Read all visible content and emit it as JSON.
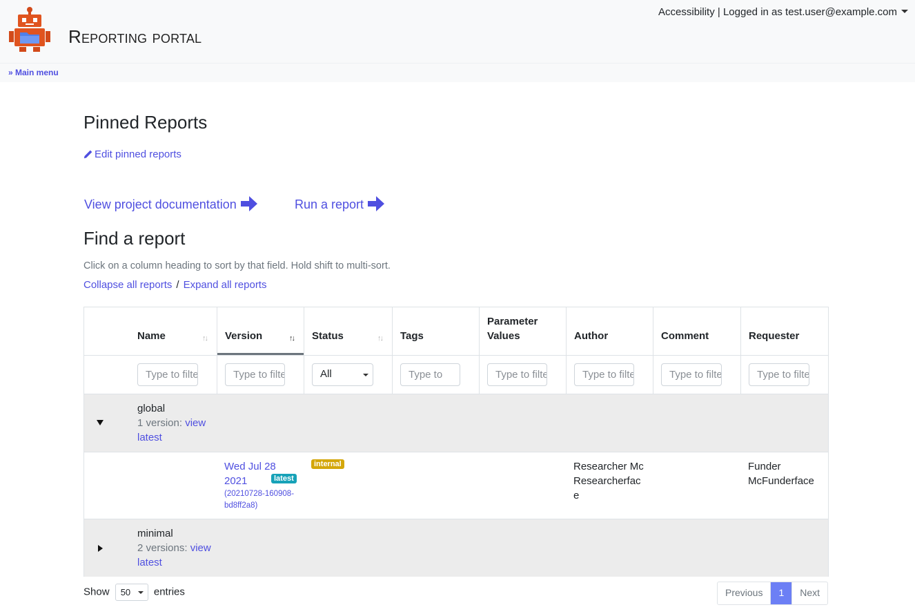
{
  "header": {
    "app_title": "Reporting portal",
    "accessibility": "Accessibility",
    "separator": "|",
    "logged_in_as": "Logged in as test.user@example.com"
  },
  "breadcrumb": {
    "main_menu": "» Main menu"
  },
  "pinned": {
    "title": "Pinned Reports",
    "edit_label": "Edit pinned reports"
  },
  "links": {
    "documentation": "View project documentation",
    "run_report": "Run a report"
  },
  "find": {
    "title": "Find a report",
    "hint": "Click on a column heading to sort by that field. Hold shift to multi-sort.",
    "collapse_all": "Collapse all reports",
    "sep": "/",
    "expand_all": "Expand all reports"
  },
  "table": {
    "columns": [
      "Name",
      "Version",
      "Status",
      "Tags",
      "Parameter Values",
      "Author",
      "Comment",
      "Requester"
    ],
    "filter_placeholders": {
      "name": "Type to filter",
      "version": "Type to filter",
      "tags": "Type to",
      "params": "Type to filter",
      "author": "Type to filter",
      "comment": "Type to filter",
      "requester": "Type to filter"
    },
    "status_select": "All",
    "groups": [
      {
        "name": "global",
        "versions_text": "1 version:",
        "view_latest": "view latest",
        "expanded": true
      },
      {
        "name": "minimal",
        "versions_text": "2 versions:",
        "view_latest": "view latest",
        "expanded": false
      }
    ],
    "version_row": {
      "date": "Wed Jul 28 2021",
      "latest_badge": "latest",
      "id": "(20210728-160908-bd8ff2a8)",
      "status_badge": "internal",
      "author": "Researcher McResearcherface",
      "requester": "Funder McFunderface"
    }
  },
  "footer": {
    "show": "Show",
    "entries_value": "50",
    "entries": "entries",
    "previous": "Previous",
    "page": "1",
    "next": "Next"
  },
  "colors": {
    "link": "#4f4fe0",
    "badge_internal": "#d4a70b",
    "badge_latest": "#17a2b8",
    "page_active": "#6c7ff5"
  }
}
